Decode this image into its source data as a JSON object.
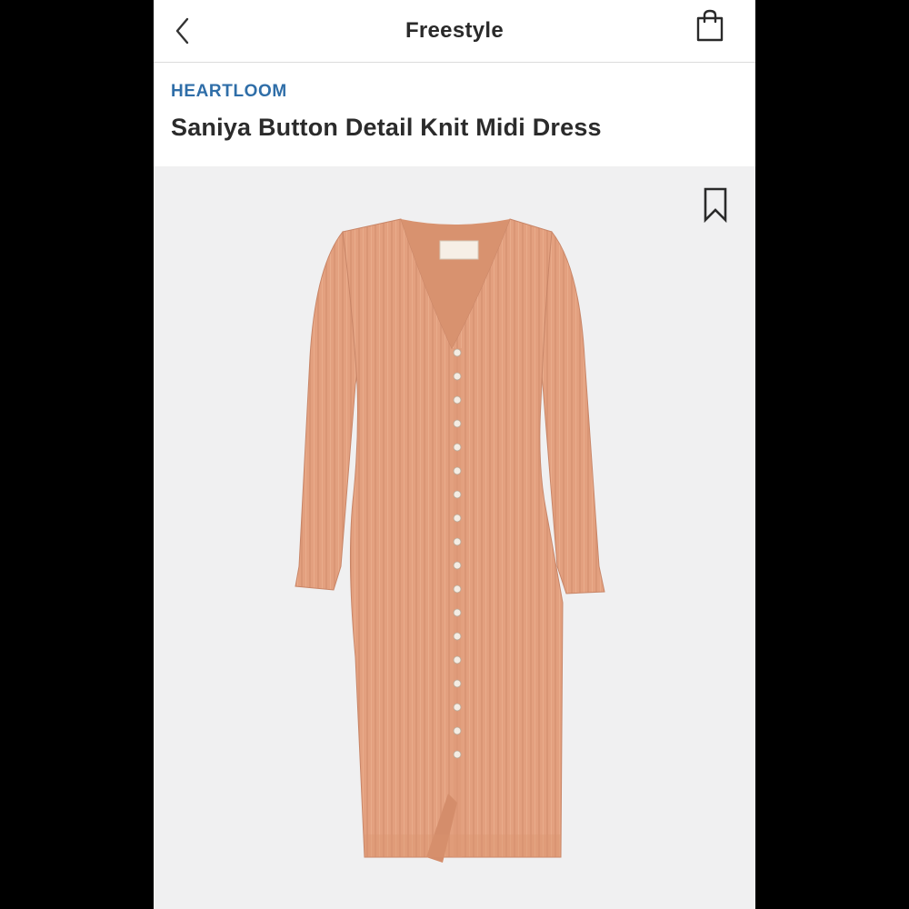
{
  "navbar": {
    "title": "Freestyle",
    "back_icon": "chevron-left-icon",
    "bag_icon": "shopping-bag-icon"
  },
  "product": {
    "brand": "HEARTLOOM",
    "title": "Saniya Button Detail Knit Midi Dress",
    "bookmark_icon": "bookmark-icon",
    "image": {
      "description_icon": "dress-image",
      "color": "#e3a07f",
      "label_text": "heartloom"
    }
  },
  "colors": {
    "brand": "#2f6ea8",
    "text": "#2b2b2b",
    "image_bg": "#f0f0f1"
  }
}
